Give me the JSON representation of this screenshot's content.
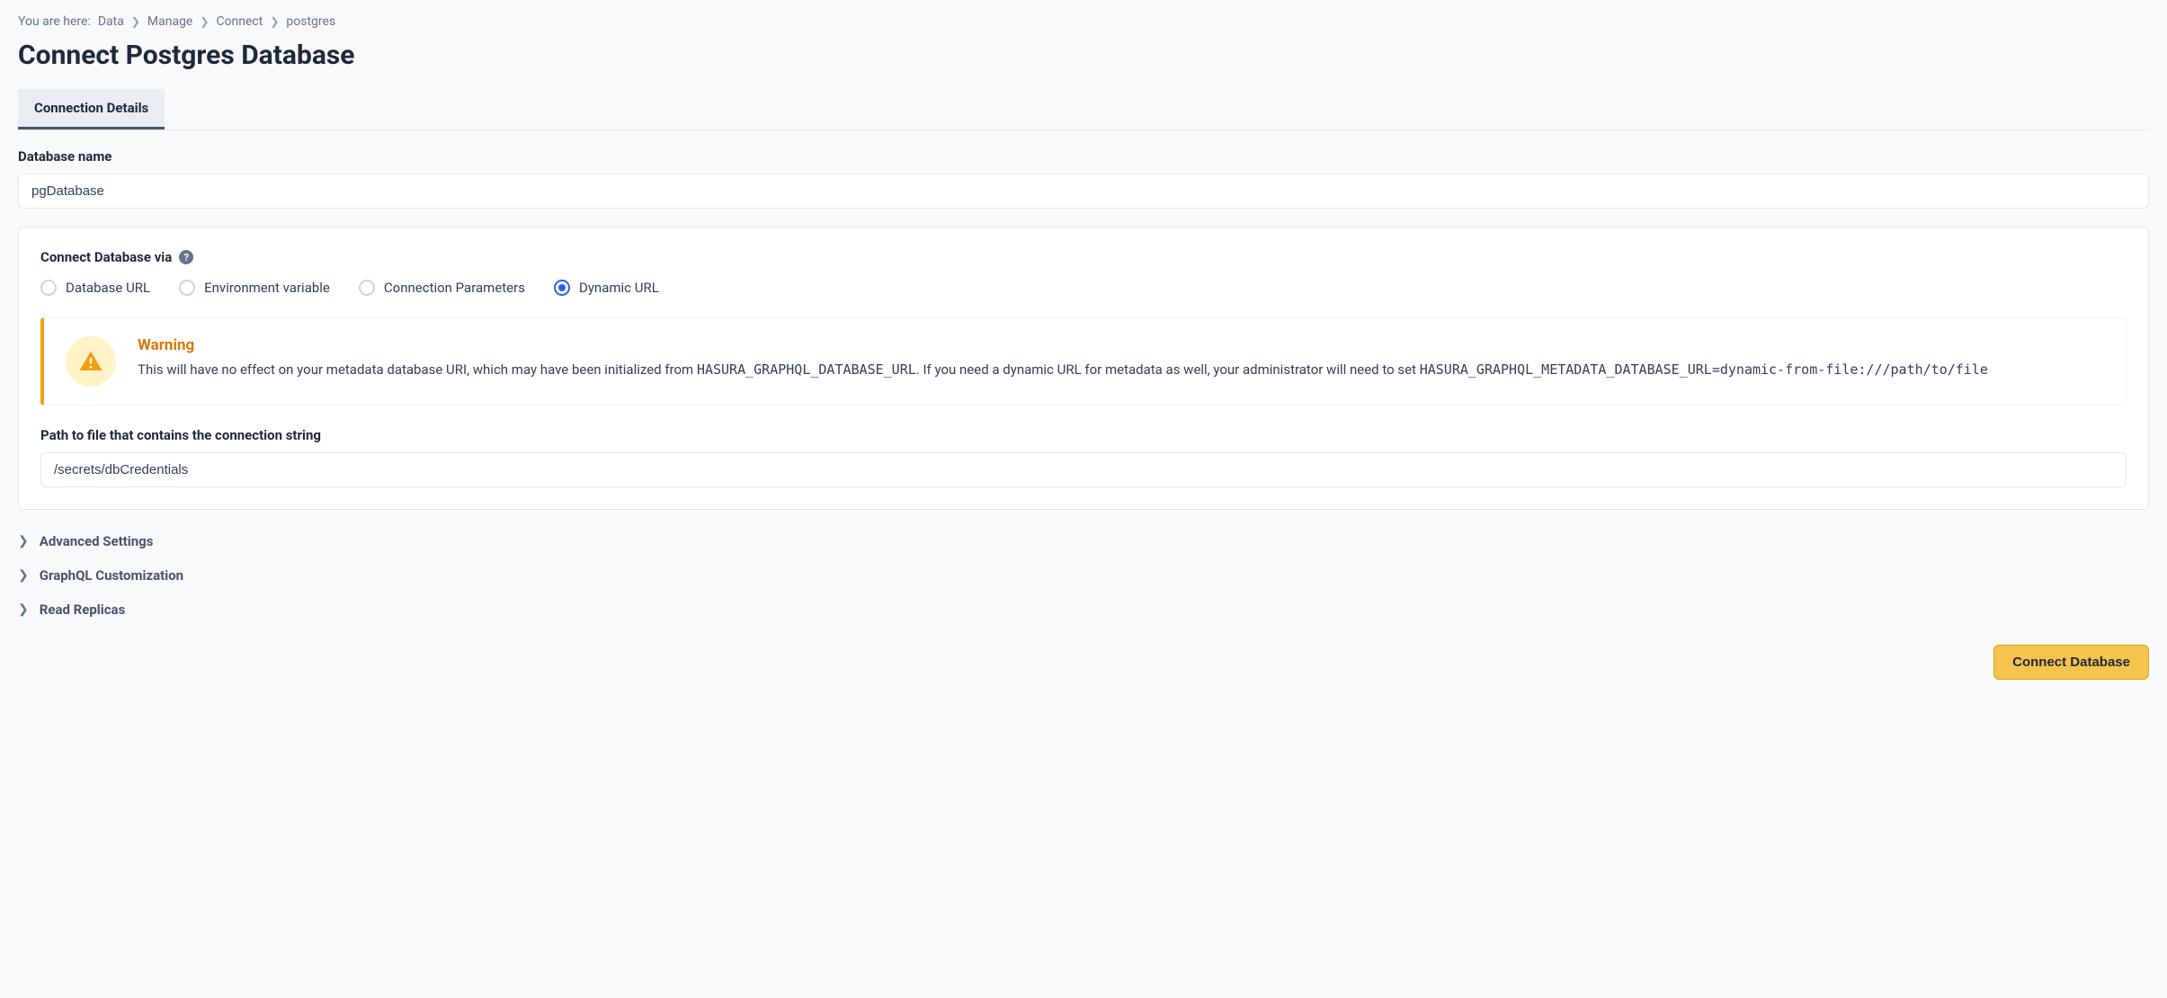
{
  "breadcrumb": {
    "prefix": "You are here:",
    "items": [
      "Data",
      "Manage",
      "Connect",
      "postgres"
    ]
  },
  "page_title": "Connect Postgres Database",
  "tabs": {
    "active": "Connection Details"
  },
  "form": {
    "db_name_label": "Database name",
    "db_name_value": "pgDatabase"
  },
  "connect_via": {
    "label": "Connect Database via",
    "options": [
      {
        "label": "Database URL",
        "checked": false
      },
      {
        "label": "Environment variable",
        "checked": false
      },
      {
        "label": "Connection Parameters",
        "checked": false
      },
      {
        "label": "Dynamic URL",
        "checked": true
      }
    ]
  },
  "warning": {
    "title": "Warning",
    "text_prefix": "This will have no effect on your metadata database URI, which may have been initialized from ",
    "env1": "HASURA_GRAPHQL_DATABASE_URL",
    "text_mid": ". If you need a dynamic URL for metadata as well, your administrator will need to set ",
    "env2": "HASURA_GRAPHQL_METADATA_DATABASE_URL=dynamic-from-file:///path/to/file"
  },
  "path_field": {
    "label": "Path to file that contains the connection string",
    "value": "/secrets/dbCredentials"
  },
  "collapsible": [
    "Advanced Settings",
    "GraphQL Customization",
    "Read Replicas"
  ],
  "actions": {
    "submit": "Connect Database"
  }
}
